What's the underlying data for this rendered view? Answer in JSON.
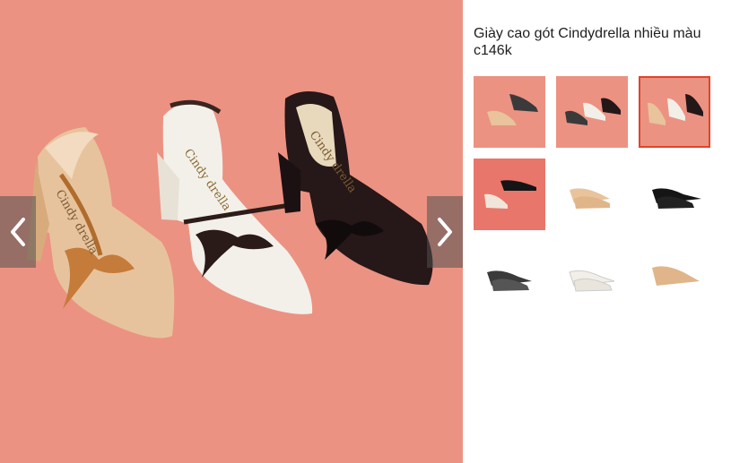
{
  "product": {
    "title": "Giày cao gót Cindydrella nhiều màu c146k",
    "brand_print": "Cindy drella"
  },
  "gallery": {
    "background_color": "#ec9282",
    "prev_icon": "chevron-left-icon",
    "next_icon": "chevron-right-icon",
    "selected_thumbnail_index": 2,
    "accent_color": "#e2432a"
  },
  "thumbnails": [
    {
      "bg": "#ec9282",
      "shoes": [
        "#e8c39b",
        "#2a2a2a"
      ]
    },
    {
      "bg": "#ec9282",
      "shoes": [
        "#3a3a3a",
        "#f2efe8",
        "#241718"
      ]
    },
    {
      "bg": "#ec9282",
      "shoes": [
        "#e8c39b",
        "#f2efe8",
        "#241718"
      ]
    },
    {
      "bg": "#e9766b",
      "shoes": [
        "#f0e5d8",
        "#151515"
      ]
    },
    {
      "bg": "#ffffff",
      "shoes": [
        "#e8c39b"
      ]
    },
    {
      "bg": "#ffffff",
      "shoes": [
        "#151515"
      ]
    },
    {
      "bg": "#ffffff",
      "shoes": [
        "#3a3a3a"
      ]
    },
    {
      "bg": "#ffffff",
      "shoes": [
        "#f2efe8"
      ]
    },
    {
      "bg": "#ffffff",
      "shoes": [
        "#e0b58a"
      ]
    }
  ]
}
